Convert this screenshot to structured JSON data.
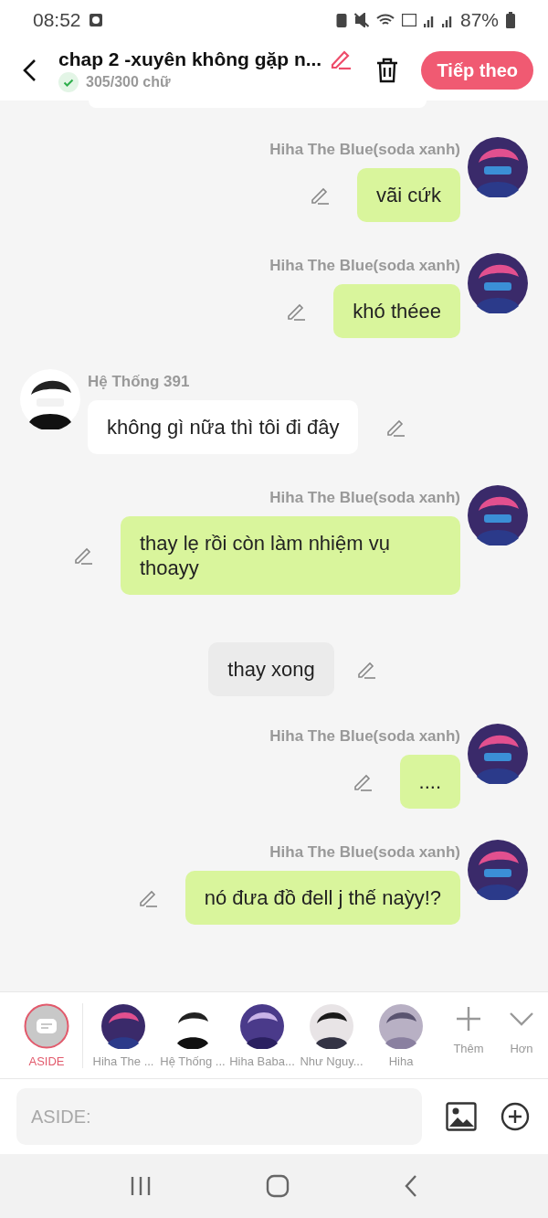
{
  "status_bar": {
    "time": "08:52",
    "battery": "87%"
  },
  "header": {
    "title": "chap 2 -xuyên không gặp n...",
    "word_count": "305/300 chữ",
    "count_ok": true,
    "next_button": "Tiếp theo"
  },
  "messages": [
    {
      "kind": "right",
      "sender": "Hiha The Blue(soda xanh)",
      "text": "vãi cứk"
    },
    {
      "kind": "right",
      "sender": "Hiha The Blue(soda xanh)",
      "text": "khó théee"
    },
    {
      "kind": "left",
      "sender": "Hệ Thống 391",
      "text": "không gì nữa thì tôi đi đây"
    },
    {
      "kind": "right",
      "sender": "Hiha The Blue(soda xanh)",
      "text": "thay lẹ rồi còn làm nhiệm vụ thoayy"
    },
    {
      "kind": "aside",
      "text": "thay xong"
    },
    {
      "kind": "right",
      "sender": "Hiha The Blue(soda xanh)",
      "text": "...."
    },
    {
      "kind": "right",
      "sender": "Hiha The Blue(soda xanh)",
      "text": "nó đưa đồ đell j thế naỳy!?"
    }
  ],
  "characters": [
    {
      "kind": "aside",
      "label": "ASIDE",
      "selected": true
    },
    {
      "kind": "avatar",
      "label": "Hiha The ...",
      "selected": false
    },
    {
      "kind": "avatar",
      "label": "Hệ Thống ...",
      "selected": false
    },
    {
      "kind": "avatar",
      "label": "Hiha Baba...",
      "selected": false
    },
    {
      "kind": "avatar",
      "label": "Như Nguy...",
      "selected": false
    },
    {
      "kind": "avatar",
      "label": "Hiha",
      "selected": false
    }
  ],
  "bar_actions": [
    {
      "kind": "add",
      "label": "Thêm"
    },
    {
      "kind": "more",
      "label": "Hơn"
    }
  ],
  "input": {
    "placeholder": "ASIDE:"
  }
}
